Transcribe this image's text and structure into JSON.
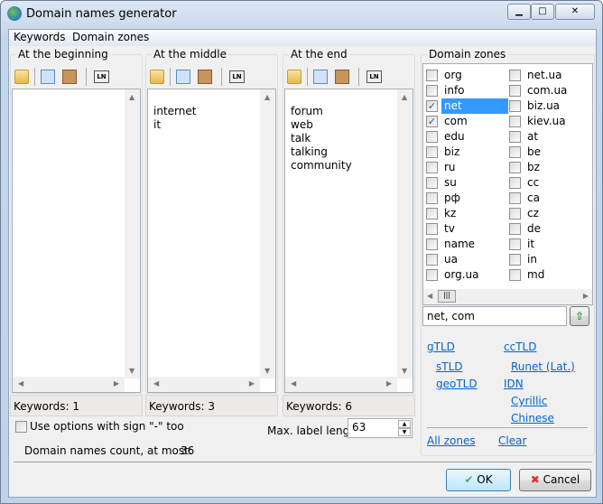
{
  "window": {
    "title": "Domain names generator",
    "minimize": "▁",
    "maximize": "□",
    "close": "✕"
  },
  "menu": [
    "Keywords",
    "Domain zones"
  ],
  "columns": [
    {
      "title": "At the beginning",
      "items": [],
      "status": "Keywords: 1"
    },
    {
      "title": "At the middle",
      "items": [
        "",
        "internet",
        "it"
      ],
      "status": "Keywords: 3"
    },
    {
      "title": "At the end",
      "items": [
        "",
        "forum",
        "web",
        "talk",
        "talking",
        "community"
      ],
      "status": "Keywords: 6"
    }
  ],
  "zones": {
    "title": "Domain zones",
    "col1": [
      {
        "label": "org",
        "checked": false
      },
      {
        "label": "info",
        "checked": false
      },
      {
        "label": "net",
        "checked": true,
        "selected": true
      },
      {
        "label": "com",
        "checked": true
      },
      {
        "label": "edu",
        "checked": false
      },
      {
        "label": "biz",
        "checked": false
      },
      {
        "label": "ru",
        "checked": false
      },
      {
        "label": "su",
        "checked": false
      },
      {
        "label": "рф",
        "checked": false
      },
      {
        "label": "kz",
        "checked": false
      },
      {
        "label": "tv",
        "checked": false
      },
      {
        "label": "name",
        "checked": false
      },
      {
        "label": "ua",
        "checked": false
      },
      {
        "label": "org.ua",
        "checked": false
      }
    ],
    "col2": [
      {
        "label": "net.ua",
        "checked": false
      },
      {
        "label": "com.ua",
        "checked": false
      },
      {
        "label": "biz.ua",
        "checked": false
      },
      {
        "label": "kiev.ua",
        "checked": false
      },
      {
        "label": "at",
        "checked": false
      },
      {
        "label": "be",
        "checked": false
      },
      {
        "label": "bz",
        "checked": false
      },
      {
        "label": "cc",
        "checked": false
      },
      {
        "label": "ca",
        "checked": false
      },
      {
        "label": "cz",
        "checked": false
      },
      {
        "label": "de",
        "checked": false
      },
      {
        "label": "it",
        "checked": false
      },
      {
        "label": "in",
        "checked": false
      },
      {
        "label": "md",
        "checked": false
      }
    ],
    "selected_value": "net, com",
    "links": {
      "gtld": "gTLD",
      "cctld": "ccTLD",
      "stld": "sTLD",
      "runet": "Runet (Lat.)",
      "geotld": "geoTLD",
      "idn": "IDN",
      "cyrillic": "Cyrillic",
      "chinese": "Chinese",
      "all": "All zones",
      "clear": "Clear"
    }
  },
  "options": {
    "use_dash_label": "Use options with sign \"-\" too",
    "use_dash_checked": false,
    "max_label_length_label": "Max. label length",
    "max_label_length": "63",
    "count_label": "Domain names count, at most:",
    "count": "36"
  },
  "buttons": {
    "ok": "OK",
    "cancel": "Cancel"
  }
}
